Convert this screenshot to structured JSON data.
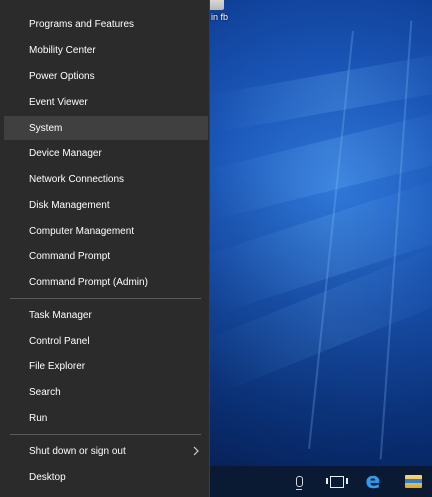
{
  "desktop": {
    "partial_icon_label": "in fb"
  },
  "winx_menu": {
    "group1": [
      {
        "label": "Programs and Features"
      },
      {
        "label": "Mobility Center"
      },
      {
        "label": "Power Options"
      },
      {
        "label": "Event Viewer"
      },
      {
        "label": "System",
        "state": "hovered"
      },
      {
        "label": "Device Manager"
      },
      {
        "label": "Network Connections"
      },
      {
        "label": "Disk Management"
      },
      {
        "label": "Computer Management"
      },
      {
        "label": "Command Prompt"
      },
      {
        "label": "Command Prompt (Admin)"
      }
    ],
    "group2": [
      {
        "label": "Task Manager"
      },
      {
        "label": "Control Panel"
      },
      {
        "label": "File Explorer"
      },
      {
        "label": "Search"
      },
      {
        "label": "Run"
      }
    ],
    "group3": [
      {
        "label": "Shut down or sign out",
        "icon": "chevron-right-icon"
      },
      {
        "label": "Desktop"
      }
    ]
  },
  "taskbar": {
    "icons": [
      "microphone-icon",
      "task-view-icon",
      "edge-icon",
      "file-explorer-icon"
    ]
  },
  "colors": {
    "menu_background": "#2b2b2b",
    "menu_hover": "#404040",
    "menu_text": "#ffffff",
    "taskbar": "#0a1a33",
    "edge_blue": "#2e9cf0"
  }
}
